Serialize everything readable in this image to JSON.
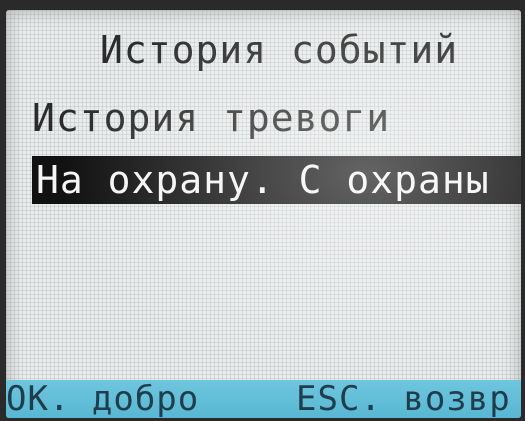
{
  "screen": {
    "title": "История событий",
    "menu": [
      {
        "label": "История тревоги"
      },
      {
        "label": "На охрану. С охраны",
        "selected": true
      }
    ],
    "softkeys": {
      "ok_label": "ОК. добро",
      "esc_label": "ESC. возвр"
    }
  },
  "colors": {
    "lcd_background": "#e9ecec",
    "text": "#2b2b2b",
    "selection_bg": "#111111",
    "selection_text": "#f4f4f4",
    "footer_bg": "#6fc6de"
  }
}
